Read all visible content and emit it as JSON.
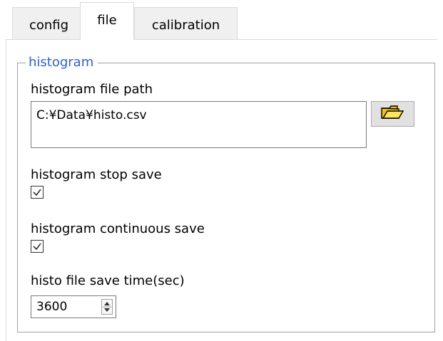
{
  "tabs": [
    {
      "label": "config",
      "selected": false
    },
    {
      "label": "file",
      "selected": true
    },
    {
      "label": "calibration",
      "selected": false
    }
  ],
  "histogram_group": {
    "title": "histogram",
    "file_path_label": "histogram file path",
    "file_path_value": "C:¥Data¥histo.csv",
    "browse_icon": "folder-open-icon",
    "stop_save_label": "histogram stop save",
    "stop_save_checked": true,
    "continuous_save_label": "histogram continuous save",
    "continuous_save_checked": true,
    "save_time_label": "histo file save time(sec)",
    "save_time_value": "3600"
  },
  "colors": {
    "group_title": "#2f5fe0",
    "folder_icon_fill": "#f4c400"
  }
}
